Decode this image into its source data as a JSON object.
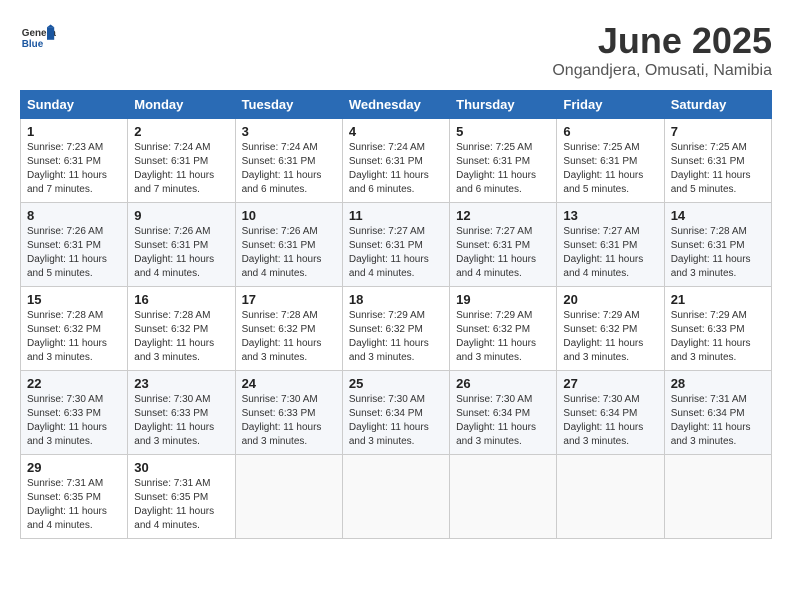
{
  "header": {
    "logo_general": "General",
    "logo_blue": "Blue",
    "title": "June 2025",
    "subtitle": "Ongandjera, Omusati, Namibia"
  },
  "days_of_week": [
    "Sunday",
    "Monday",
    "Tuesday",
    "Wednesday",
    "Thursday",
    "Friday",
    "Saturday"
  ],
  "weeks": [
    [
      {
        "day": "1",
        "sunrise": "7:23 AM",
        "sunset": "6:31 PM",
        "daylight": "11 hours and 7 minutes."
      },
      {
        "day": "2",
        "sunrise": "7:24 AM",
        "sunset": "6:31 PM",
        "daylight": "11 hours and 7 minutes."
      },
      {
        "day": "3",
        "sunrise": "7:24 AM",
        "sunset": "6:31 PM",
        "daylight": "11 hours and 6 minutes."
      },
      {
        "day": "4",
        "sunrise": "7:24 AM",
        "sunset": "6:31 PM",
        "daylight": "11 hours and 6 minutes."
      },
      {
        "day": "5",
        "sunrise": "7:25 AM",
        "sunset": "6:31 PM",
        "daylight": "11 hours and 6 minutes."
      },
      {
        "day": "6",
        "sunrise": "7:25 AM",
        "sunset": "6:31 PM",
        "daylight": "11 hours and 5 minutes."
      },
      {
        "day": "7",
        "sunrise": "7:25 AM",
        "sunset": "6:31 PM",
        "daylight": "11 hours and 5 minutes."
      }
    ],
    [
      {
        "day": "8",
        "sunrise": "7:26 AM",
        "sunset": "6:31 PM",
        "daylight": "11 hours and 5 minutes."
      },
      {
        "day": "9",
        "sunrise": "7:26 AM",
        "sunset": "6:31 PM",
        "daylight": "11 hours and 4 minutes."
      },
      {
        "day": "10",
        "sunrise": "7:26 AM",
        "sunset": "6:31 PM",
        "daylight": "11 hours and 4 minutes."
      },
      {
        "day": "11",
        "sunrise": "7:27 AM",
        "sunset": "6:31 PM",
        "daylight": "11 hours and 4 minutes."
      },
      {
        "day": "12",
        "sunrise": "7:27 AM",
        "sunset": "6:31 PM",
        "daylight": "11 hours and 4 minutes."
      },
      {
        "day": "13",
        "sunrise": "7:27 AM",
        "sunset": "6:31 PM",
        "daylight": "11 hours and 4 minutes."
      },
      {
        "day": "14",
        "sunrise": "7:28 AM",
        "sunset": "6:31 PM",
        "daylight": "11 hours and 3 minutes."
      }
    ],
    [
      {
        "day": "15",
        "sunrise": "7:28 AM",
        "sunset": "6:32 PM",
        "daylight": "11 hours and 3 minutes."
      },
      {
        "day": "16",
        "sunrise": "7:28 AM",
        "sunset": "6:32 PM",
        "daylight": "11 hours and 3 minutes."
      },
      {
        "day": "17",
        "sunrise": "7:28 AM",
        "sunset": "6:32 PM",
        "daylight": "11 hours and 3 minutes."
      },
      {
        "day": "18",
        "sunrise": "7:29 AM",
        "sunset": "6:32 PM",
        "daylight": "11 hours and 3 minutes."
      },
      {
        "day": "19",
        "sunrise": "7:29 AM",
        "sunset": "6:32 PM",
        "daylight": "11 hours and 3 minutes."
      },
      {
        "day": "20",
        "sunrise": "7:29 AM",
        "sunset": "6:32 PM",
        "daylight": "11 hours and 3 minutes."
      },
      {
        "day": "21",
        "sunrise": "7:29 AM",
        "sunset": "6:33 PM",
        "daylight": "11 hours and 3 minutes."
      }
    ],
    [
      {
        "day": "22",
        "sunrise": "7:30 AM",
        "sunset": "6:33 PM",
        "daylight": "11 hours and 3 minutes."
      },
      {
        "day": "23",
        "sunrise": "7:30 AM",
        "sunset": "6:33 PM",
        "daylight": "11 hours and 3 minutes."
      },
      {
        "day": "24",
        "sunrise": "7:30 AM",
        "sunset": "6:33 PM",
        "daylight": "11 hours and 3 minutes."
      },
      {
        "day": "25",
        "sunrise": "7:30 AM",
        "sunset": "6:34 PM",
        "daylight": "11 hours and 3 minutes."
      },
      {
        "day": "26",
        "sunrise": "7:30 AM",
        "sunset": "6:34 PM",
        "daylight": "11 hours and 3 minutes."
      },
      {
        "day": "27",
        "sunrise": "7:30 AM",
        "sunset": "6:34 PM",
        "daylight": "11 hours and 3 minutes."
      },
      {
        "day": "28",
        "sunrise": "7:31 AM",
        "sunset": "6:34 PM",
        "daylight": "11 hours and 3 minutes."
      }
    ],
    [
      {
        "day": "29",
        "sunrise": "7:31 AM",
        "sunset": "6:35 PM",
        "daylight": "11 hours and 4 minutes."
      },
      {
        "day": "30",
        "sunrise": "7:31 AM",
        "sunset": "6:35 PM",
        "daylight": "11 hours and 4 minutes."
      },
      null,
      null,
      null,
      null,
      null
    ]
  ],
  "labels": {
    "sunrise_prefix": "Sunrise: ",
    "sunset_prefix": "Sunset: ",
    "daylight_prefix": "Daylight: "
  }
}
